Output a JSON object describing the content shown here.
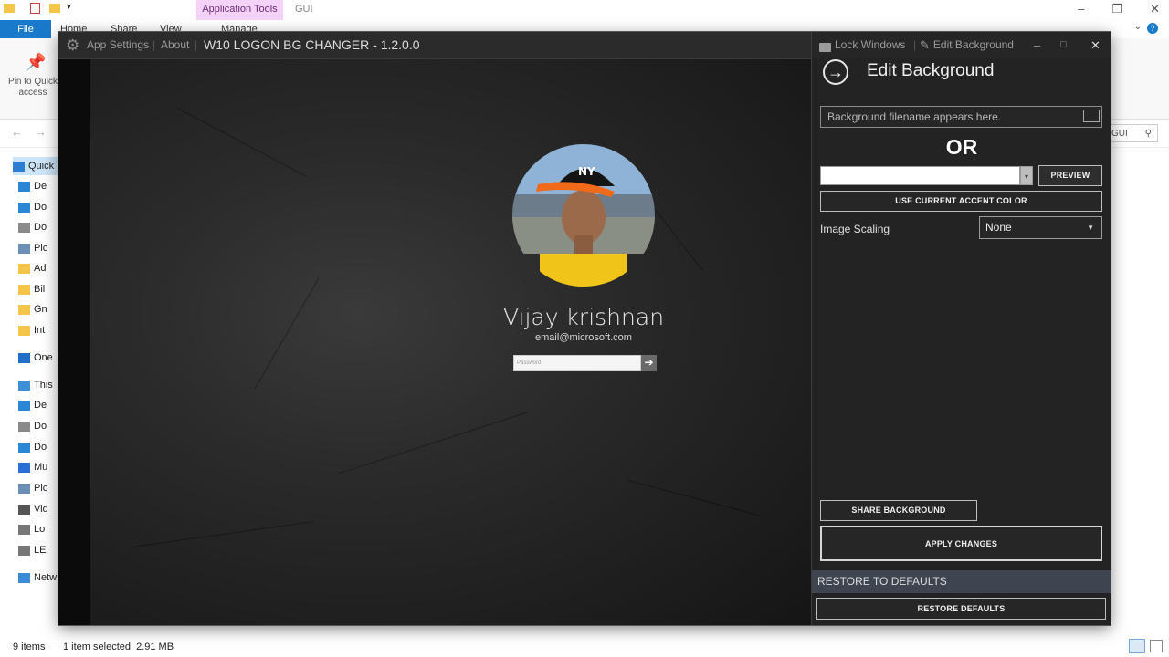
{
  "explorer": {
    "ribbon_tabs": [
      "File",
      "Home",
      "Share",
      "View",
      "Manage"
    ],
    "context_tab_group": "Application Tools",
    "folder_title": "GUI",
    "pin_label": "Pin to Quick access",
    "search_text": "GUI",
    "nav_items": [
      {
        "label": "Quick",
        "icon": "star-icon"
      },
      {
        "label": "De",
        "icon": "desktop-icon"
      },
      {
        "label": "Do",
        "icon": "download-icon"
      },
      {
        "label": "Do",
        "icon": "document-icon"
      },
      {
        "label": "Pic",
        "icon": "pictures-icon"
      },
      {
        "label": "Ad",
        "icon": "folder-icon"
      },
      {
        "label": "Bil",
        "icon": "folder-icon"
      },
      {
        "label": "Gn",
        "icon": "folder-icon"
      },
      {
        "label": "Int",
        "icon": "folder-icon"
      },
      {
        "label": "One",
        "icon": "onedrive-icon"
      },
      {
        "label": "This",
        "icon": "this-pc-icon"
      },
      {
        "label": "De",
        "icon": "desktop-icon"
      },
      {
        "label": "Do",
        "icon": "document-icon"
      },
      {
        "label": "Do",
        "icon": "download-icon"
      },
      {
        "label": "Mu",
        "icon": "music-icon"
      },
      {
        "label": "Pic",
        "icon": "pictures-icon"
      },
      {
        "label": "Vid",
        "icon": "video-icon"
      },
      {
        "label": "Lo",
        "icon": "drive-icon"
      },
      {
        "label": "LE",
        "icon": "drive-icon"
      },
      {
        "label": "Netw",
        "icon": "network-icon"
      }
    ],
    "status": {
      "items": "9 items",
      "selection": "1 item selected  2.91 MB"
    }
  },
  "app": {
    "settings_label": "App Settings",
    "about_label": "About",
    "title": "W10 LOGON BG CHANGER - 1.2.0.0",
    "lock_windows": "Lock Windows",
    "edit_background_tb": "Edit Background",
    "preview": {
      "user_name": "Vijay krishnan",
      "user_email": "email@microsoft.com",
      "password_placeholder": "Password"
    },
    "panel": {
      "title": "Edit Background",
      "filename_placeholder": "Background filename appears here.",
      "or_label": "OR",
      "color_value": "",
      "preview_button": "PREVIEW",
      "accent_button": "USE CURRENT ACCENT COLOR",
      "scaling_label": "Image Scaling",
      "scaling_value": "None",
      "share_button": "SHARE BACKGROUND",
      "apply_button": "APPLY CHANGES",
      "restore_heading": "RESTORE TO DEFAULTS",
      "restore_button": "RESTORE DEFAULTS"
    }
  },
  "colors": {
    "accent_file_tab": "#1979ca",
    "context_band": "#f5d3f8",
    "panel_bg": "#232323",
    "restore_band": "#3e4550"
  }
}
